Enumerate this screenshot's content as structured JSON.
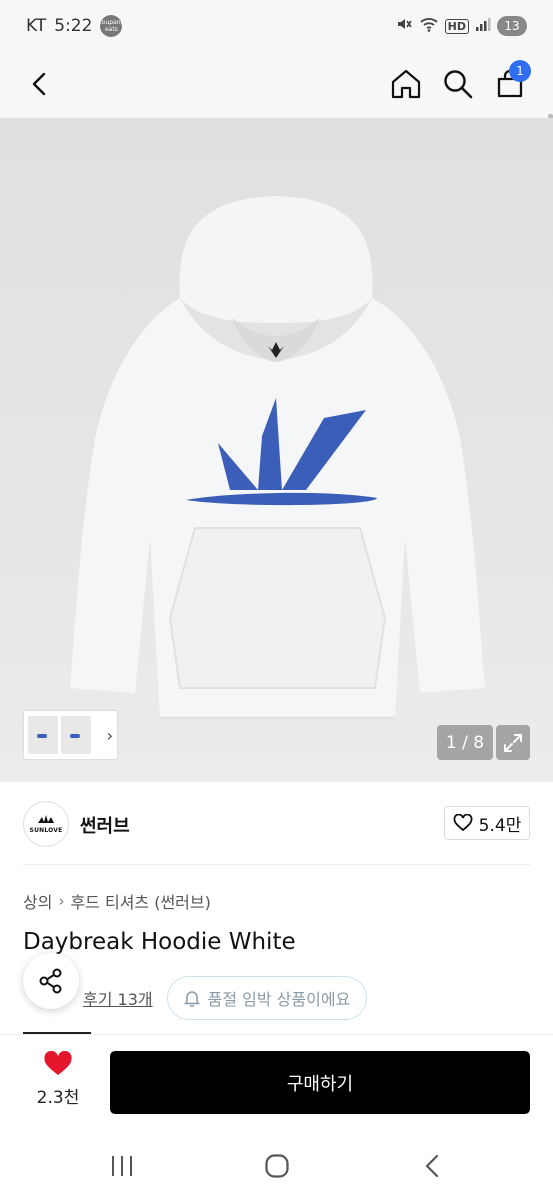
{
  "status_bar": {
    "carrier": "KT",
    "time": "5:22",
    "app_badge": "coupang eats",
    "hd_label": "HD",
    "battery": "13"
  },
  "header": {
    "cart_count": "1"
  },
  "gallery": {
    "counter": "1 / 8"
  },
  "brand": {
    "logo_text": "SUNLOVE",
    "name": "썬러브",
    "likes": "5.4만"
  },
  "breadcrumb": [
    "상의",
    "후드 티셔츠 (썬러브)"
  ],
  "product": {
    "title": "Daybreak Hoodie White",
    "review_link": "후기 13개",
    "soldout_notice": "품절 임박 상품이에요"
  },
  "bottom_bar": {
    "wish_count": "2.3천",
    "buy_label": "구매하기"
  },
  "colors": {
    "accent_blue": "#2f6ef2",
    "logo_blue": "#3b5fb8",
    "buy_button": "#000000"
  },
  "icons": [
    "back-icon",
    "home-icon",
    "search-icon",
    "cart-icon",
    "expand-icon",
    "heart-outline-icon",
    "heart-filled-icon",
    "share-icon",
    "bell-icon"
  ]
}
